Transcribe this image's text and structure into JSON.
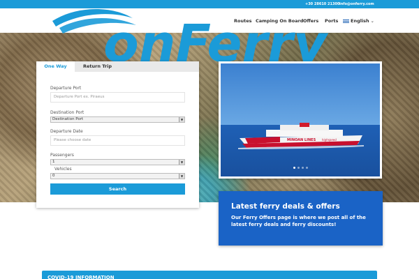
{
  "topbar": {
    "phone": "+30 28610 21300",
    "email": "info@onferry.com"
  },
  "brand": {
    "logo_text": "onFerry",
    "primary": "#1b9bd8",
    "offers_bg": "#1a63c6"
  },
  "nav": [
    {
      "label": "Routes"
    },
    {
      "label": "Camping On Board"
    },
    {
      "label": "Offers"
    },
    {
      "label": "Ports"
    },
    {
      "label": "English"
    }
  ],
  "form": {
    "tabs": {
      "one_way": "One Way",
      "return_trip": "Return Trip"
    },
    "departure_label": "Departure Port",
    "departure_placeholder": "Departure Port ex. Piraeus",
    "destination_label": "Destination Port",
    "destination_value": "Destination Port",
    "date_label": "Departure Date",
    "date_placeholder": "Please choose date",
    "passengers_label": "Passengers",
    "passengers_value": "1",
    "vehicles_label": "Vehicles",
    "vehicles_value": "0",
    "search_label": "Search"
  },
  "slider": {
    "ship_brand": "MINOAN LINES",
    "ship_tag": "highspeed",
    "slides": 4,
    "active": 1
  },
  "offers": {
    "title": "Latest ferry deals & offers",
    "text": "Our Ferry Offers page is where we post all of the latest ferry deals and ferry discounts!"
  },
  "covid": {
    "title": "COVID-19 INFORMATION"
  }
}
